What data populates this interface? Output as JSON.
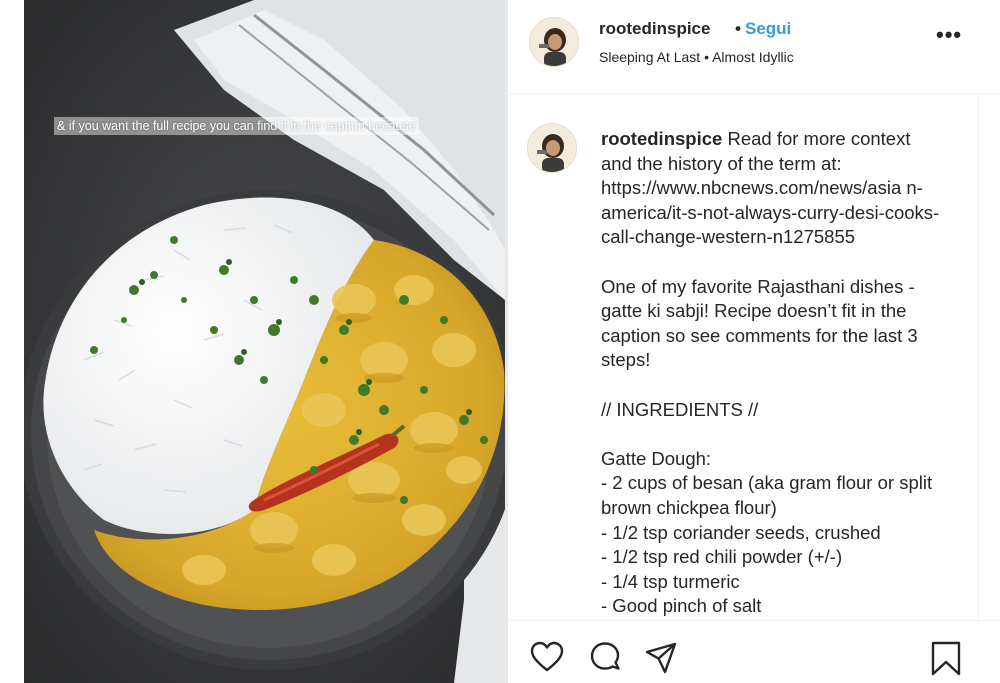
{
  "media": {
    "overlay_text": "& if you want the full recipe you can find it in the caption because"
  },
  "post": {
    "username": "rootedinspice",
    "separator": "•",
    "follow_label": "Segui",
    "music": "Sleeping At Last • Almost Idyllic",
    "more_label": "•••"
  },
  "caption": {
    "username": "rootedinspice",
    "text": " Read for more context and the history of the term at: https://www.nbcnews.com/news/asia n-america/it-s-not-always-curry-desi-cooks-call-change-western-n1275855\n\nOne of my favorite Rajasthani dishes - gatte ki sabji! Recipe doesn’t fit in the caption so see comments for the last 3 steps!\n\n// INGREDIENTS //\n\nGatte Dough:\n- 2 cups of besan (aka gram flour or split brown chickpea flour)\n- 1/2 tsp coriander seeds, crushed\n- 1/2 tsp red chili powder (+/-)\n- 1/4 tsp turmeric\n- Good pinch of salt"
  },
  "actions": {
    "like": "heart-icon",
    "comment": "comment-icon",
    "share": "share-icon",
    "save": "bookmark-icon"
  },
  "colors": {
    "follow": "#3b99e0",
    "text": "#262626",
    "border": "#efefef"
  }
}
